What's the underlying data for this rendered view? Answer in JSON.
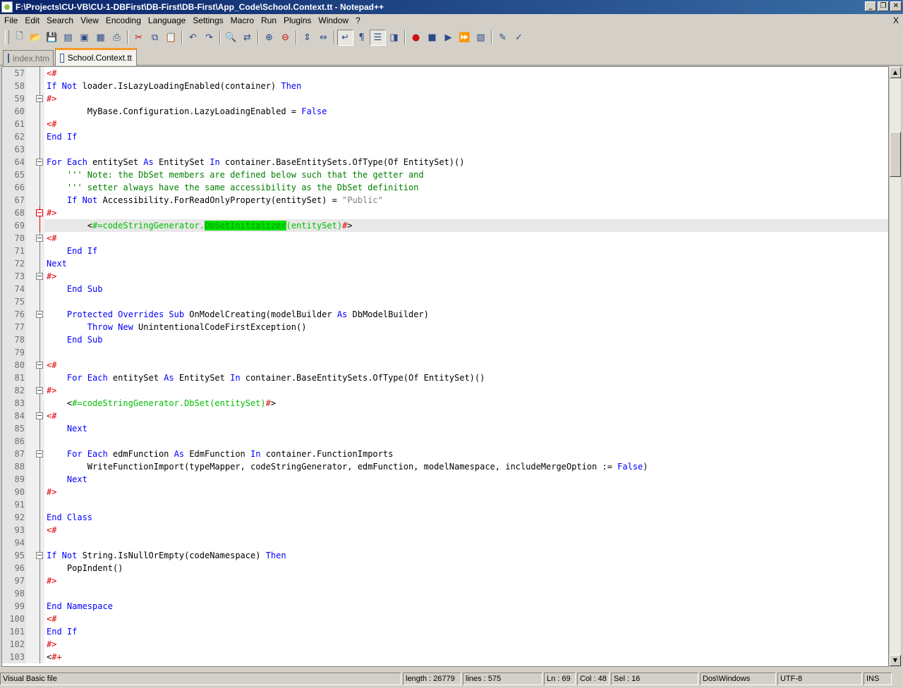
{
  "window": {
    "title": "F:\\Projects\\CU-VB\\CU-1-DBFirst\\DB-First\\DB-First\\App_Code\\School.Context.tt - Notepad++",
    "buttons": [
      "_",
      "❐",
      "✕"
    ]
  },
  "menu": {
    "items": [
      "File",
      "Edit",
      "Search",
      "View",
      "Encoding",
      "Language",
      "Settings",
      "Macro",
      "Run",
      "Plugins",
      "Window",
      "?"
    ],
    "close": "X"
  },
  "toolbar": {
    "icons": [
      "new-icon",
      "open-icon",
      "save-icon",
      "save-all-icon",
      "close-icon",
      "close-all-icon",
      "print-icon",
      "cut-icon",
      "copy-icon",
      "paste-icon",
      "undo-icon",
      "redo-icon",
      "find-icon",
      "replace-icon",
      "zoom-in-icon",
      "zoom-out-icon",
      "sync-vertical-icon",
      "sync-horizontal-icon",
      "word-wrap-icon",
      "show-all-chars-icon",
      "indent-guide-icon",
      "user-lang-icon",
      "record-macro-icon",
      "stop-record-icon",
      "play-macro-icon",
      "run-multiple-icon",
      "save-macro-icon",
      "trim-icon",
      "spellcheck-icon"
    ]
  },
  "tabs": [
    {
      "label": "index.htm",
      "active": false
    },
    {
      "label": "School.Context.tt",
      "active": true
    }
  ],
  "editor": {
    "current_line": 69,
    "lines": [
      {
        "n": "57",
        "fold": "line",
        "red": false,
        "code": [
          [
            "d",
            "<#"
          ]
        ]
      },
      {
        "n": "58",
        "fold": "line",
        "red": false,
        "code": [
          [
            "k",
            "If Not "
          ],
          [
            "t",
            "loader.IsLazyLoadingEnabled(container) "
          ],
          [
            "k",
            "Then"
          ]
        ]
      },
      {
        "n": "59",
        "fold": "box",
        "red": false,
        "code": [
          [
            "d",
            "#>"
          ]
        ]
      },
      {
        "n": "60",
        "fold": "line",
        "red": false,
        "code": [
          [
            "t",
            "        MyBase.Configuration.LazyLoadingEnabled = "
          ],
          [
            "k",
            "False"
          ]
        ]
      },
      {
        "n": "61",
        "fold": "line",
        "red": false,
        "code": [
          [
            "d",
            "<#"
          ]
        ]
      },
      {
        "n": "62",
        "fold": "line",
        "red": false,
        "code": [
          [
            "k",
            "End If"
          ]
        ]
      },
      {
        "n": "63",
        "fold": "line",
        "red": false,
        "code": []
      },
      {
        "n": "64",
        "fold": "box",
        "red": false,
        "code": [
          [
            "k",
            "For Each "
          ],
          [
            "t",
            "entitySet "
          ],
          [
            "k",
            "As "
          ],
          [
            "t",
            "EntitySet "
          ],
          [
            "k",
            "In "
          ],
          [
            "t",
            "container.BaseEntitySets.OfType(Of EntitySet)()"
          ]
        ]
      },
      {
        "n": "65",
        "fold": "line",
        "red": false,
        "code": [
          [
            "c",
            "    ''' Note: the DbSet members are defined below such that the getter and"
          ]
        ]
      },
      {
        "n": "66",
        "fold": "line",
        "red": false,
        "code": [
          [
            "c",
            "    ''' setter always have the same accessibility as the DbSet definition"
          ]
        ]
      },
      {
        "n": "67",
        "fold": "line",
        "red": false,
        "code": [
          [
            "k",
            "    If Not "
          ],
          [
            "t",
            "Accessibility.ForReadOnlyProperty(entitySet) = "
          ],
          [
            "s",
            "\"Public\""
          ]
        ]
      },
      {
        "n": "68",
        "fold": "box",
        "red": true,
        "code": [
          [
            "d",
            "#>"
          ]
        ]
      },
      {
        "n": "69",
        "fold": "line",
        "red": true,
        "code": [
          [
            "t",
            "        <"
          ],
          [
            "g",
            "#=codeStringGenerator."
          ],
          [
            "hl",
            "DbSetInitializer"
          ],
          [
            "g",
            "(entitySet)"
          ],
          [
            "d",
            "#"
          ],
          [
            "t",
            ">"
          ]
        ]
      },
      {
        "n": "70",
        "fold": "box",
        "red": false,
        "code": [
          [
            "d",
            "<#"
          ]
        ]
      },
      {
        "n": "71",
        "fold": "line",
        "red": false,
        "code": [
          [
            "k",
            "    End If"
          ]
        ]
      },
      {
        "n": "72",
        "fold": "line",
        "red": false,
        "code": [
          [
            "k",
            "Next"
          ]
        ]
      },
      {
        "n": "73",
        "fold": "box",
        "red": false,
        "code": [
          [
            "d",
            "#>"
          ]
        ]
      },
      {
        "n": "74",
        "fold": "line",
        "red": false,
        "code": [
          [
            "k",
            "    End Sub"
          ]
        ]
      },
      {
        "n": "75",
        "fold": "line",
        "red": false,
        "code": []
      },
      {
        "n": "76",
        "fold": "box",
        "red": false,
        "code": [
          [
            "k",
            "    Protected Overrides Sub "
          ],
          [
            "t",
            "OnModelCreating(modelBuilder "
          ],
          [
            "k",
            "As "
          ],
          [
            "t",
            "DbModelBuilder)"
          ]
        ]
      },
      {
        "n": "77",
        "fold": "line",
        "red": false,
        "code": [
          [
            "k",
            "        Throw New "
          ],
          [
            "t",
            "UnintentionalCodeFirstException()"
          ]
        ]
      },
      {
        "n": "78",
        "fold": "line",
        "red": false,
        "code": [
          [
            "k",
            "    End Sub"
          ]
        ]
      },
      {
        "n": "79",
        "fold": "line",
        "red": false,
        "code": []
      },
      {
        "n": "80",
        "fold": "box",
        "red": false,
        "code": [
          [
            "d",
            "<#"
          ]
        ]
      },
      {
        "n": "81",
        "fold": "line",
        "red": false,
        "code": [
          [
            "k",
            "    For Each "
          ],
          [
            "t",
            "entitySet "
          ],
          [
            "k",
            "As "
          ],
          [
            "t",
            "EntitySet "
          ],
          [
            "k",
            "In "
          ],
          [
            "t",
            "container.BaseEntitySets.OfType(Of EntitySet)()"
          ]
        ]
      },
      {
        "n": "82",
        "fold": "box",
        "red": false,
        "code": [
          [
            "d",
            "#>"
          ]
        ]
      },
      {
        "n": "83",
        "fold": "line",
        "red": false,
        "code": [
          [
            "t",
            "    <"
          ],
          [
            "g",
            "#=codeStringGenerator.DbSet(entitySet)"
          ],
          [
            "d",
            "#"
          ],
          [
            "t",
            ">"
          ]
        ]
      },
      {
        "n": "84",
        "fold": "box",
        "red": false,
        "code": [
          [
            "d",
            "<#"
          ]
        ]
      },
      {
        "n": "85",
        "fold": "line",
        "red": false,
        "code": [
          [
            "k",
            "    Next"
          ]
        ]
      },
      {
        "n": "86",
        "fold": "line",
        "red": false,
        "code": []
      },
      {
        "n": "87",
        "fold": "box",
        "red": false,
        "code": [
          [
            "k",
            "    For Each "
          ],
          [
            "t",
            "edmFunction "
          ],
          [
            "k",
            "As "
          ],
          [
            "t",
            "EdmFunction "
          ],
          [
            "k",
            "In "
          ],
          [
            "t",
            "container.FunctionImports"
          ]
        ]
      },
      {
        "n": "88",
        "fold": "line",
        "red": false,
        "code": [
          [
            "t",
            "        WriteFunctionImport(typeMapper, codeStringGenerator, edmFunction, modelNamespace, includeMergeOption := "
          ],
          [
            "k",
            "False"
          ],
          [
            "t",
            ")"
          ]
        ]
      },
      {
        "n": "89",
        "fold": "line",
        "red": false,
        "code": [
          [
            "k",
            "    Next"
          ]
        ]
      },
      {
        "n": "90",
        "fold": "line",
        "red": false,
        "code": [
          [
            "d",
            "#>"
          ]
        ]
      },
      {
        "n": "91",
        "fold": "line",
        "red": false,
        "code": []
      },
      {
        "n": "92",
        "fold": "line",
        "red": false,
        "code": [
          [
            "k",
            "End Class"
          ]
        ]
      },
      {
        "n": "93",
        "fold": "line",
        "red": false,
        "code": [
          [
            "d",
            "<#"
          ]
        ]
      },
      {
        "n": "94",
        "fold": "line",
        "red": false,
        "code": []
      },
      {
        "n": "95",
        "fold": "box",
        "red": false,
        "code": [
          [
            "k",
            "If Not "
          ],
          [
            "t",
            "String.IsNullOrEmpty(codeNamespace) "
          ],
          [
            "k",
            "Then"
          ]
        ]
      },
      {
        "n": "96",
        "fold": "line",
        "red": false,
        "code": [
          [
            "t",
            "    PopIndent()"
          ]
        ]
      },
      {
        "n": "97",
        "fold": "line",
        "red": false,
        "code": [
          [
            "d",
            "#>"
          ]
        ]
      },
      {
        "n": "98",
        "fold": "line",
        "red": false,
        "code": []
      },
      {
        "n": "99",
        "fold": "line",
        "red": false,
        "code": [
          [
            "k",
            "End Namespace"
          ]
        ]
      },
      {
        "n": "100",
        "fold": "line",
        "red": false,
        "code": [
          [
            "d",
            "<#"
          ]
        ]
      },
      {
        "n": "101",
        "fold": "line",
        "red": false,
        "code": [
          [
            "k",
            "End If"
          ]
        ]
      },
      {
        "n": "102",
        "fold": "line",
        "red": false,
        "code": [
          [
            "d",
            "#>"
          ]
        ]
      },
      {
        "n": "103",
        "fold": "line",
        "red": false,
        "code": [
          [
            "t",
            "<"
          ],
          [
            "d",
            "#+"
          ]
        ]
      }
    ]
  },
  "status": {
    "filetype": "Visual Basic file",
    "length": "length : 26779",
    "lines": "lines : 575",
    "ln": "Ln : 69",
    "col": "Col : 48",
    "sel": "Sel : 16",
    "eol": "Dos\\Windows",
    "encoding": "UTF-8",
    "mode": "INS"
  },
  "scroll": {
    "up": "▲",
    "down": "▼"
  }
}
